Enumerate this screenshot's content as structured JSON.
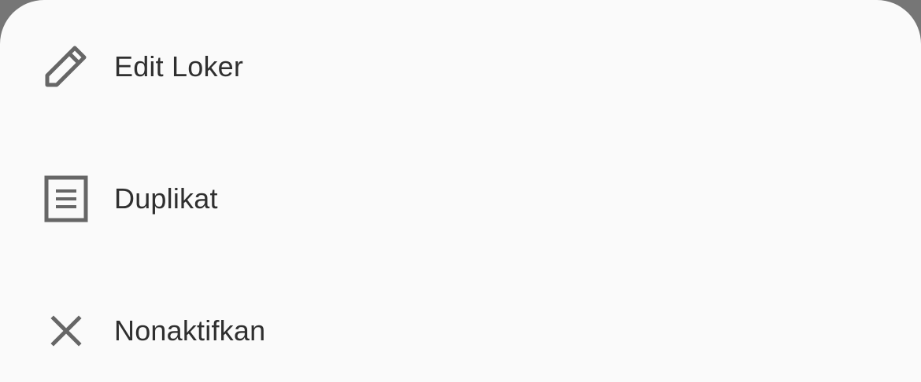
{
  "menu": {
    "items": [
      {
        "label": "Edit Loker",
        "icon": "pencil-icon"
      },
      {
        "label": "Duplikat",
        "icon": "document-icon"
      },
      {
        "label": "Nonaktifkan",
        "icon": "close-icon"
      }
    ]
  },
  "colors": {
    "sheet_background": "#fafafa",
    "backdrop": "#767676",
    "icon": "#666666",
    "text": "#2f2f2f"
  }
}
